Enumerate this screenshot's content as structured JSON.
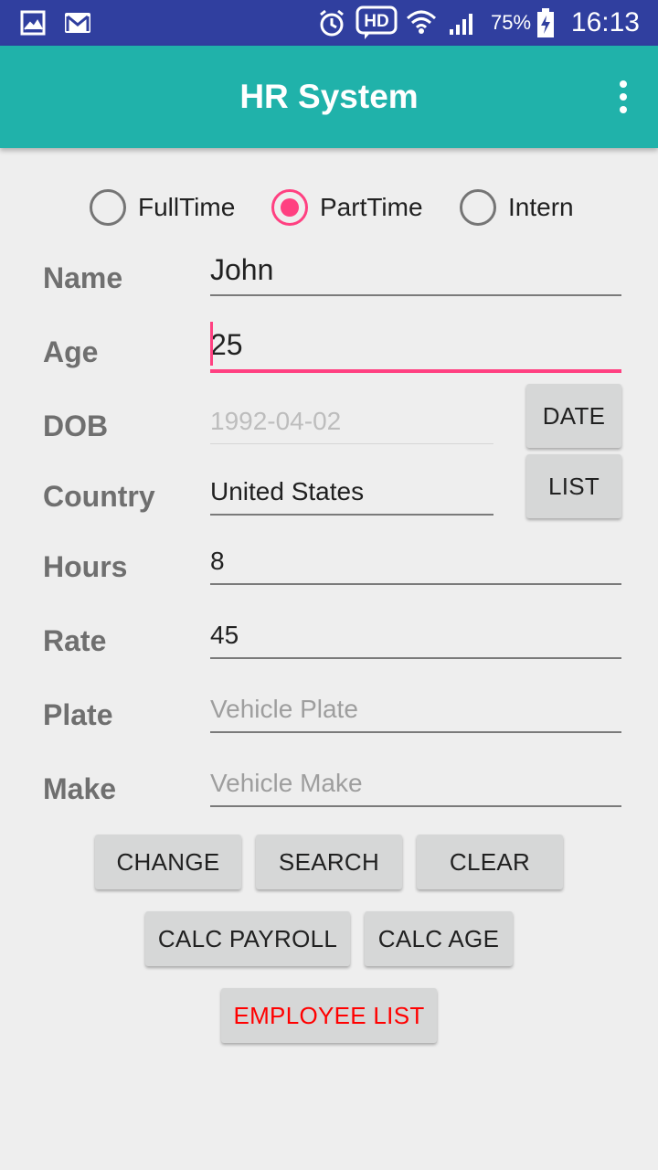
{
  "status_bar": {
    "battery_percent": "75%",
    "time": "16:13",
    "icons": [
      "gallery-icon",
      "gmail-icon",
      "alarm-icon",
      "hd-voice-icon",
      "wifi-icon",
      "signal-icon",
      "battery-charging-icon"
    ]
  },
  "app_bar": {
    "title": "HR System",
    "menu_icon": "overflow-menu-icon"
  },
  "employee_type": {
    "options": [
      {
        "label": "FullTime",
        "checked": false
      },
      {
        "label": "PartTime",
        "checked": true
      },
      {
        "label": "Intern",
        "checked": false
      }
    ]
  },
  "form": {
    "name": {
      "label": "Name",
      "value": "John"
    },
    "age": {
      "label": "Age",
      "value": "25"
    },
    "dob": {
      "label": "DOB",
      "value": "1992-04-02"
    },
    "country": {
      "label": "Country",
      "value": "United States"
    },
    "hours": {
      "label": "Hours",
      "value": "8"
    },
    "rate": {
      "label": "Rate",
      "value": "45"
    },
    "plate": {
      "label": "Plate",
      "value": "",
      "placeholder": "Vehicle Plate"
    },
    "make": {
      "label": "Make",
      "value": "",
      "placeholder": "Vehicle Make"
    }
  },
  "buttons": {
    "date": "DATE",
    "list": "LIST",
    "change": "CHANGE",
    "search": "SEARCH",
    "clear": "CLEAR",
    "calc_payroll": "CALC PAYROLL",
    "calc_age": "CALC AGE",
    "employee_list": "EMPLOYEE LIST"
  },
  "colors": {
    "status_bar": "#303f9f",
    "app_bar": "#20b2aa",
    "accent": "#ff4081",
    "employee_list_text": "#ff0000"
  }
}
